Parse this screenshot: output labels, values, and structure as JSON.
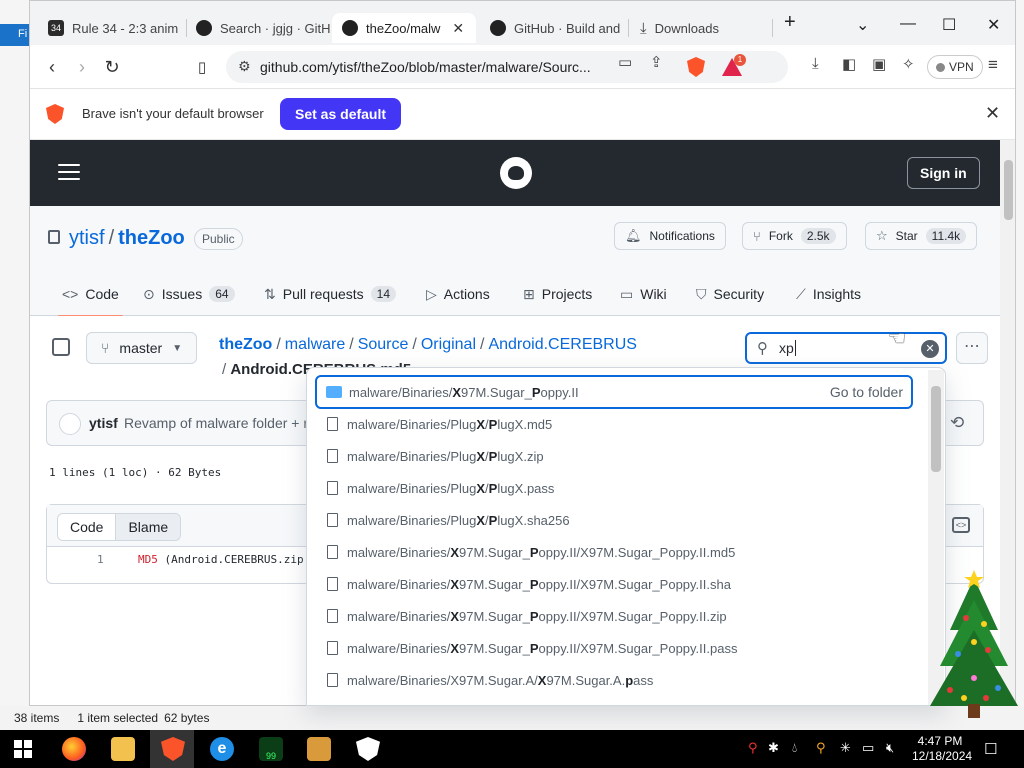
{
  "desktop": {
    "bg_tab_label": "Fi",
    "explorer_status": {
      "items": "38 items",
      "selected": "1 item selected",
      "size": "62 bytes"
    }
  },
  "browser": {
    "tabs": [
      {
        "label": "Rule 34 - 2:3 anim",
        "icon": "favicon-34"
      },
      {
        "label": "Search · jgjg · GitH",
        "icon": "github-icon"
      },
      {
        "label": "theZoo/malw",
        "icon": "github-icon",
        "active": true
      },
      {
        "label": "GitHub · Build and",
        "icon": "github-icon"
      },
      {
        "label": "Downloads",
        "icon": "download-icon"
      }
    ],
    "new_tab": "+",
    "url": "github.com/ytisf/theZoo/blob/master/malware/Sourc...",
    "rewards_badge": "1",
    "vpn_label": "VPN"
  },
  "infobar": {
    "message": "Brave isn't your default browser",
    "button": "Set as default"
  },
  "github": {
    "sign_in": "Sign in",
    "owner": "ytisf",
    "repo": "theZoo",
    "visibility": "Public",
    "notifications": "Notifications",
    "fork": "Fork",
    "fork_count": "2.5k",
    "star": "Star",
    "star_count": "11.4k",
    "tabs": [
      {
        "label": "Code",
        "icon": "code-icon"
      },
      {
        "label": "Issues",
        "count": "64",
        "icon": "issue-icon"
      },
      {
        "label": "Pull requests",
        "count": "14",
        "icon": "pull-request-icon"
      },
      {
        "label": "Actions",
        "icon": "play-icon"
      },
      {
        "label": "Projects",
        "icon": "table-icon"
      },
      {
        "label": "Wiki",
        "icon": "book-icon"
      },
      {
        "label": "Security",
        "icon": "shield-icon"
      },
      {
        "label": "Insights",
        "icon": "graph-icon"
      }
    ],
    "branch": "master",
    "breadcrumb": [
      "theZoo",
      "malware",
      "Source",
      "Original",
      "Android.CEREBRUS"
    ],
    "breadcrumb_file": "Android.CEREBRUS.md5",
    "search_value": "xp",
    "commit_user": "ytisf",
    "commit_message": "Revamp of malware folder + r",
    "file_meta": "1 lines (1 loc) · 62 Bytes",
    "code_tab": "Code",
    "blame_tab": "Blame",
    "code_line_number": "1",
    "code_keyword": "MD5",
    "code_rest": " (Android.CEREBRUS.zip",
    "go_to_folder": "Go to folder",
    "results": [
      "malware/Binaries/X97M.Sugar_Poppy.II",
      "malware/Binaries/PlugX/PlugX.md5",
      "malware/Binaries/PlugX/PlugX.zip",
      "malware/Binaries/PlugX/PlugX.pass",
      "malware/Binaries/PlugX/PlugX.sha256",
      "malware/Binaries/X97M.Sugar_Poppy.II/X97M.Sugar_Poppy.II.md5",
      "malware/Binaries/X97M.Sugar_Poppy.II/X97M.Sugar_Poppy.II.sha",
      "malware/Binaries/X97M.Sugar_Poppy.II/X97M.Sugar_Poppy.II.zip",
      "malware/Binaries/X97M.Sugar_Poppy.II/X97M.Sugar_Poppy.II.pass",
      "malware/Binaries/X97M.Sugar.A/X97M.Sugar.A.pass"
    ]
  },
  "taskbar": {
    "time": "4:47 PM",
    "date": "12/18/2024",
    "badge": "99"
  },
  "colors": {
    "github_header": "#24292f",
    "link_blue": "#0969da",
    "brave_orange": "#fb542b",
    "set_default_button": "#4436f5"
  }
}
